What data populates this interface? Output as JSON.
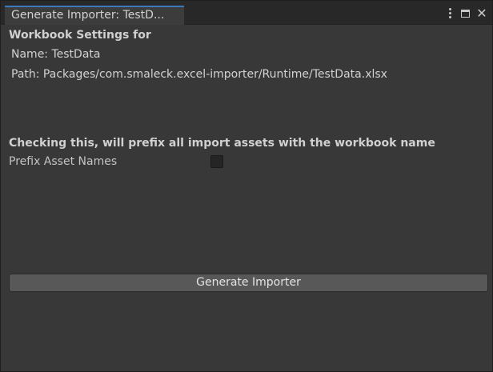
{
  "window": {
    "tab_title": "Generate Importer: TestD..."
  },
  "workbook": {
    "heading": "Workbook Settings for",
    "name_line": "Name: TestData",
    "path_line": "Path: Packages/com.smaleck.excel-importer/Runtime/TestData.xlsx"
  },
  "prefix": {
    "description": "Checking this, will prefix all import assets with the workbook name",
    "label": "Prefix Asset Names",
    "checked": false
  },
  "actions": {
    "generate_label": "Generate Importer"
  },
  "colors": {
    "background": "#383838",
    "tab_accent": "#3a79bb",
    "button": "#585858"
  },
  "icons": [
    "kebab-menu-icon",
    "maximize-icon",
    "close-icon"
  ]
}
